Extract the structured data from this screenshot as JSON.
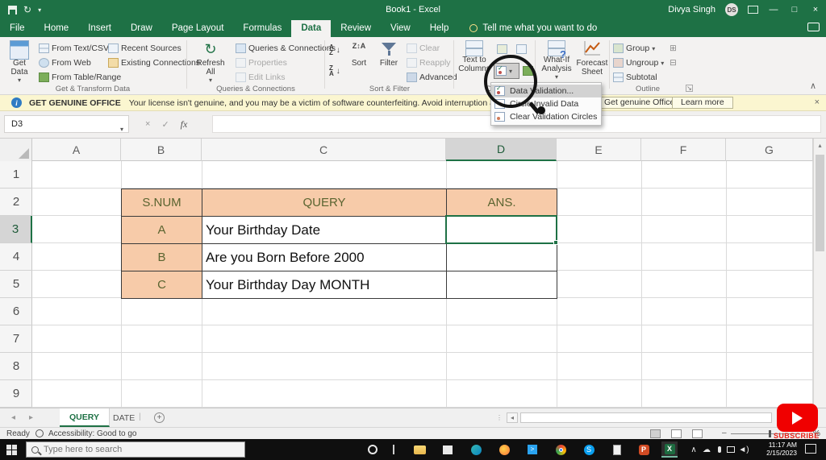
{
  "window": {
    "title": "Book1 - Excel",
    "user": "Divya Singh",
    "user_initials": "DS"
  },
  "tabs": {
    "items": [
      "File",
      "Home",
      "Insert",
      "Draw",
      "Page Layout",
      "Formulas",
      "Data",
      "Review",
      "View",
      "Help"
    ],
    "active": "Data",
    "tell_me": "Tell me what you want to do"
  },
  "ribbon": {
    "get_transform": {
      "label": "Get & Transform Data",
      "get_data": "Get Data",
      "from_text_csv": "From Text/CSV",
      "from_web": "From Web",
      "from_table": "From Table/Range",
      "recent_sources": "Recent Sources",
      "existing_connections": "Existing Connections"
    },
    "queries": {
      "label": "Queries & Connections",
      "refresh_all": "Refresh All",
      "queries_connections": "Queries & Connections",
      "properties": "Properties",
      "edit_links": "Edit Links"
    },
    "sort_filter": {
      "label": "Sort & Filter",
      "sort": "Sort",
      "filter": "Filter",
      "clear": "Clear",
      "reapply": "Reapply",
      "advanced": "Advanced"
    },
    "data_tools": {
      "label": "Data",
      "text_to_columns": "Text to Columns"
    },
    "forecast": {
      "what_if": "What-If Analysis",
      "forecast_sheet": "Forecast Sheet"
    },
    "outline": {
      "label": "Outline",
      "group": "Group",
      "ungroup": "Ungroup",
      "subtotal": "Subtotal"
    }
  },
  "banner": {
    "title": "GET GENUINE OFFICE",
    "message": "Your license isn't genuine, and you may be a victim of software counterfeiting. Avoid interruption and keep your files safe w",
    "button_get": "Get genuine Office",
    "button_learn": "Learn more"
  },
  "validation_menu": {
    "items": [
      "Data Validation...",
      "Circle Invalid Data",
      "Clear Validation Circles"
    ]
  },
  "formula_bar": {
    "name_box": "D3"
  },
  "sheet": {
    "columns": [
      "A",
      "B",
      "C",
      "D",
      "E",
      "F",
      "G"
    ],
    "rows": [
      "1",
      "2",
      "3",
      "4",
      "5",
      "6",
      "7",
      "8",
      "9"
    ],
    "selected_cell": "D3",
    "table": {
      "headers": [
        "S.NUM",
        "QUERY",
        "ANS."
      ],
      "rows": [
        [
          "A",
          "Your Birthday Date"
        ],
        [
          "B",
          "Are you Born Before 2000"
        ],
        [
          "C",
          "Your Birthday Day MONTH"
        ]
      ]
    }
  },
  "sheet_tabs": {
    "query": "QUERY",
    "date": "DATE"
  },
  "status_bar": {
    "ready": "Ready",
    "accessibility": "Accessibility: Good to go",
    "zoom_text": "%"
  },
  "taskbar": {
    "search_placeholder": "Type here to search",
    "time": "11:17 AM",
    "date": "2/15/2023"
  },
  "overlay": {
    "subscribe": "SUBSCRIBE"
  },
  "colors": {
    "excel_green": "#1e7145",
    "table_fill": "#f7cba9",
    "table_text": "#5a6430",
    "banner_bg": "#fbf6d0",
    "youtube_red": "#f00000"
  }
}
